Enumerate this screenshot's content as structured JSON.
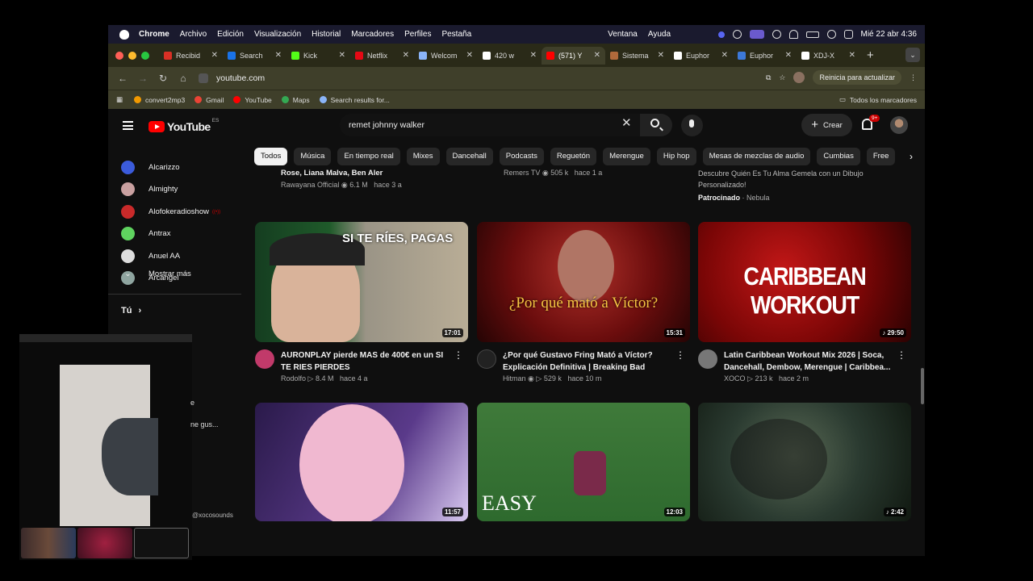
{
  "menubar": {
    "app": "Chrome",
    "items": [
      "Archivo",
      "Edición",
      "Visualización",
      "Historial",
      "Marcadores",
      "Perfiles",
      "Pestaña"
    ],
    "right_items": [
      "Ventana",
      "Ayuda"
    ],
    "datetime": "Mié 22 abr 4:36"
  },
  "tabs": [
    {
      "label": "Recibid",
      "color": "#d93025"
    },
    {
      "label": "Search",
      "color": "#1a73e8"
    },
    {
      "label": "Kick",
      "color": "#53fc18"
    },
    {
      "label": "Netflix",
      "color": "#e50914"
    },
    {
      "label": "Welcom",
      "color": "#8ab4f8"
    },
    {
      "label": "420 w",
      "color": "#ffffff"
    },
    {
      "label": "(571) Y",
      "color": "#ff0000",
      "active": true
    },
    {
      "label": "Sistema",
      "color": "#b06a3b"
    },
    {
      "label": "Euphor",
      "color": "#ffffff"
    },
    {
      "label": "Euphor",
      "color": "#3c78d8"
    },
    {
      "label": "XDJ-X",
      "color": "#ffffff"
    }
  ],
  "address": {
    "url": "youtube.com",
    "update_label": "Reinicia para actualizar"
  },
  "bookmarks": {
    "items": [
      {
        "label": "convert2mp3",
        "color": "#f29900"
      },
      {
        "label": "Gmail",
        "color": "#ea4335"
      },
      {
        "label": "YouTube",
        "color": "#ff0000"
      },
      {
        "label": "Maps",
        "color": "#34a853"
      },
      {
        "label": "Search results for...",
        "color": "#8ab4f8"
      }
    ],
    "all_label": "Todos los marcadores"
  },
  "youtube": {
    "logo": "YouTube",
    "region": "ES",
    "search_value": "remet johnny walker",
    "create_label": "Crear",
    "notif_badge": "9+"
  },
  "sidebar": {
    "subscriptions": [
      {
        "label": "Alcarizzo",
        "color": "#3b5bdb"
      },
      {
        "label": "Almighty",
        "color": "#c9a0a0"
      },
      {
        "label": "Alofokeradioshow",
        "color": "#c92a2a",
        "live": true
      },
      {
        "label": "Antrax",
        "color": "#5fd35f"
      },
      {
        "label": "Anuel AA",
        "color": "#dddddd"
      },
      {
        "label": "Arcangel",
        "color": "#8fa5a0"
      }
    ],
    "more_label": "Mostrar más",
    "you_label": "Tú",
    "peek_1": "e",
    "peek_2": "ne gus...",
    "handle_overlay": "@xocosounds"
  },
  "chips": [
    "Todos",
    "Música",
    "En tiempo real",
    "Mixes",
    "Dancehall",
    "Podcasts",
    "Reguetón",
    "Merengue",
    "Hip hop",
    "Mesas de mezclas de audio",
    "Cumbias",
    "Free"
  ],
  "top_row": {
    "col1_title": "Rose, Liana Malva, Ben Aler",
    "col1_meta": "Rawayana Official",
    "col1_views": "6.1 M",
    "col1_age": "hace 3 a",
    "col2_meta": "Remers TV",
    "col2_views": "505 k",
    "col2_age": "hace 1 a",
    "col3_line1": "Descubre Quién Es Tu Alma Gemela con un Dibujo",
    "col3_line2": "Personalizado!",
    "col3_sponsored": "Patrocinado",
    "col3_sponsor": "Nebula"
  },
  "videos": [
    {
      "title": "AURONPLAY pierde MAS de 400€ en un SI TE RIES PIERDES",
      "channel": "Rodolfo",
      "views": "8.4 M",
      "age": "hace 4 a",
      "duration": "17:01",
      "verified": false,
      "thumb_text": "SI TE RÍES, PAGAS"
    },
    {
      "title": "¿Por qué Gustavo Fring Mató a Víctor? Explicación Definitiva | Breaking Bad",
      "channel": "Hitman",
      "views": "529 k",
      "age": "hace 10 m",
      "duration": "15:31",
      "verified": true,
      "thumb_text": "¿Por qué mató a Víctor?"
    },
    {
      "title": "Latin Caribbean Workout Mix 2026 | Soca, Dancehall, Dembow, Merengue | Caribbea...",
      "channel": "XOCO",
      "views": "213 k",
      "age": "hace 2 m",
      "duration": "29:50",
      "verified": false,
      "thumb_text": "CARIBBEAN WORKOUT"
    },
    {
      "duration": "11:57"
    },
    {
      "duration": "12:03",
      "thumb_text": "EASY"
    },
    {
      "duration": "2:42"
    }
  ]
}
